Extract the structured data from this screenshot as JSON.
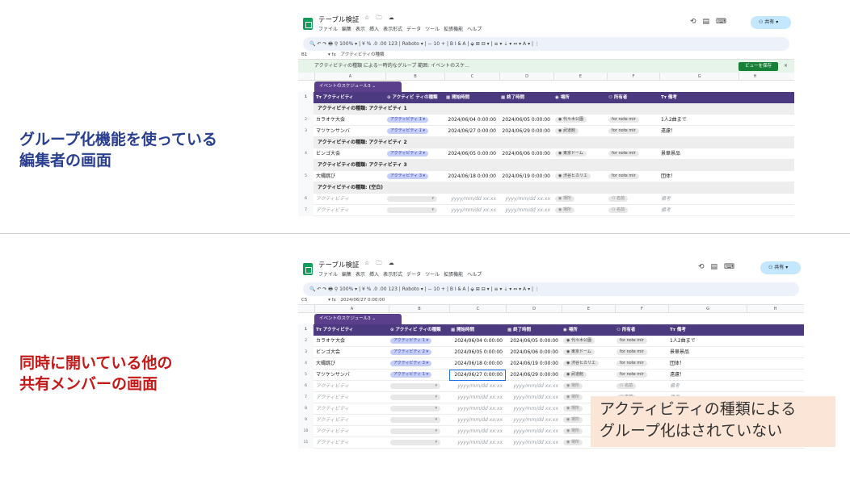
{
  "captions": {
    "top": [
      "グループ化機能を使っている",
      "編集者の画面"
    ],
    "bottom": [
      "同時に開いている他の",
      "共有メンバーの画面"
    ]
  },
  "note": [
    "アクティビティの種類による",
    "グループ化はされていない"
  ],
  "sheet": {
    "title": "テーブル検証",
    "title_icons": "☆ 🗀 ☁",
    "menus": [
      "ファイル",
      "編集",
      "表示",
      "挿入",
      "表示形式",
      "データ",
      "ツール",
      "拡張機能",
      "ヘルプ"
    ],
    "share_label": "共有",
    "toolbar_text": "🔍  ↶  ↷  🖶  ⚲   100% ▾  |  ¥   %  .0  .00  123  |  Roboto ▾  |  −  10  +  |  B  I  S̶  A  |  ⬙  ⊞  ⊟ ▾  |  ≡ ▾  ⇣ ▾  ⇔ ▾  A ▾  |  ⋮",
    "col_letters": [
      "A",
      "B",
      "C",
      "D",
      "E",
      "F",
      "G",
      "H"
    ],
    "table_tab": "イベントのスケジュール3 ⌄",
    "headers": [
      "Tт アクティビティ",
      "⊙ アクティビ ティの種類",
      "▦ 開始時間",
      "▦ 終了時間",
      "◉ 場所",
      "⚇ 所有者",
      "Tт 備考"
    ]
  },
  "editor": {
    "namebox": "B1",
    "formula": "アクティビティの種類",
    "groupbar_text": "アクティビティの種類 による一時的なグループ   範囲: イベントのスケ...",
    "view_save": "ビューを保存",
    "close": "×",
    "rows": [
      {
        "type": "group",
        "n": "",
        "text": "アクティビティの種類: アクティビティ 1"
      },
      {
        "type": "data",
        "n": "2",
        "cells": [
          "カラオケ大会",
          "アクティビティ 1 ▾",
          "2024/06/04 0:00:00",
          "2024/06/05 0:00:00",
          "◉ 代々木公園",
          "for note mir",
          "1人2曲まで"
        ]
      },
      {
        "type": "data",
        "n": "3",
        "cells": [
          "マツケンサンバ",
          "アクティビティ 1 ▾",
          "2024/06/27 0:00:00",
          "2024/06/29 0:00:00",
          "◉ 武道館",
          "for note mir",
          "遠慮！"
        ]
      },
      {
        "type": "group",
        "n": "",
        "text": "アクティビティの種類: アクティビティ 2"
      },
      {
        "type": "data",
        "n": "4",
        "cells": [
          "ビンゴ大会",
          "アクティビティ 2 ▾",
          "2024/06/05 0:00:00",
          "2024/06/06 0:00:00",
          "◉ 東京ドーム",
          "for note mir",
          "景華景品"
        ]
      },
      {
        "type": "group",
        "n": "",
        "text": "アクティビティの種類: アクティビティ 3"
      },
      {
        "type": "data",
        "n": "5",
        "cells": [
          "大縄跳び",
          "アクティビティ 3 ▾",
          "2024/06/18 0:00:00",
          "2024/06/19 0:00:00",
          "◉ 渋谷ヒカリエ",
          "for note mir",
          "団体！"
        ]
      },
      {
        "type": "group",
        "n": "",
        "text": "アクティビティの種類: (空白)"
      },
      {
        "type": "data",
        "n": "6",
        "cells": [
          "アクティビティ",
          "▾",
          "yyyy/mm/dd xx:xx",
          "yyyy/mm/dd xx:xx",
          "◉ 場所",
          "⚇ 名前",
          "備考"
        ],
        "empty": true
      },
      {
        "type": "data",
        "n": "7",
        "cells": [
          "アクティビティ",
          "▾",
          "yyyy/mm/dd xx:xx",
          "yyyy/mm/dd xx:xx",
          "◉ 場所",
          "⚇ 名前",
          "備考"
        ],
        "empty": true
      }
    ]
  },
  "member": {
    "namebox": "C5",
    "formula": "2024/06/27 0:00:00",
    "rows": [
      {
        "n": "2",
        "cells": [
          "カラオケ大会",
          "アクティビティ 1 ▾",
          "2024/06/04 0:00:00",
          "2024/06/05 0:00:00",
          "◉ 代々木公園",
          "for note mir",
          "1人2曲まで"
        ]
      },
      {
        "n": "3",
        "cells": [
          "ビンゴ大会",
          "アクティビティ 2 ▾",
          "2024/06/05 0:00:00",
          "2024/06/06 0:00:00",
          "◉ 東京ドーム",
          "for note mir",
          "景華景品"
        ]
      },
      {
        "n": "4",
        "cells": [
          "大縄跳び",
          "アクティビティ 3 ▾",
          "2024/06/18 0:00:00",
          "2024/06/19 0:00:00",
          "◉ 渋谷ヒカリエ",
          "for note mir",
          "団体！"
        ]
      },
      {
        "n": "5",
        "cells": [
          "マツケンサンバ",
          "アクティビティ 1 ▾",
          "2024/06/27 0:00:00",
          "2024/06/29 0:00:00",
          "◉ 武道館",
          "for note mir",
          "遠慮！"
        ]
      },
      {
        "n": "6",
        "cells": [
          "アクティビティ",
          "▾",
          "yyyy/mm/dd xx:xx",
          "yyyy/mm/dd xx:xx",
          "◉ 場所",
          "⚇ 名前",
          "備考"
        ],
        "empty": true
      },
      {
        "n": "7",
        "cells": [
          "アクティビティ",
          "▾",
          "yyyy/mm/dd xx:xx",
          "yyyy/mm/dd xx:xx",
          "◉ 場所",
          "⚇ 名前",
          "備考"
        ],
        "empty": true
      },
      {
        "n": "8",
        "cells": [
          "アクティビティ",
          "▾",
          "yyyy/mm/dd xx:xx",
          "yyyy/mm/dd xx:xx",
          "◉ 場所",
          "⚇ 名前",
          "備考"
        ],
        "empty": true
      },
      {
        "n": "9",
        "cells": [
          "アクティビティ",
          "▾",
          "yyyy/mm/dd xx:xx",
          "yyyy/mm/dd xx:xx",
          "◉ 場所",
          "⚇ 名前",
          "備考"
        ],
        "empty": true
      },
      {
        "n": "10",
        "cells": [
          "アクティビティ",
          "▾",
          "yyyy/mm/dd xx:xx",
          "yyyy/mm/dd xx:xx",
          "◉ 場所",
          "⚇ 名前",
          "備考"
        ],
        "empty": true
      },
      {
        "n": "11",
        "cells": [
          "アクティビティ",
          "▾",
          "yyyy/mm/dd xx:xx",
          "yyyy/mm/dd xx:xx",
          "◉ 場所",
          "⚇ 名前",
          "備考"
        ],
        "empty": true
      }
    ]
  }
}
